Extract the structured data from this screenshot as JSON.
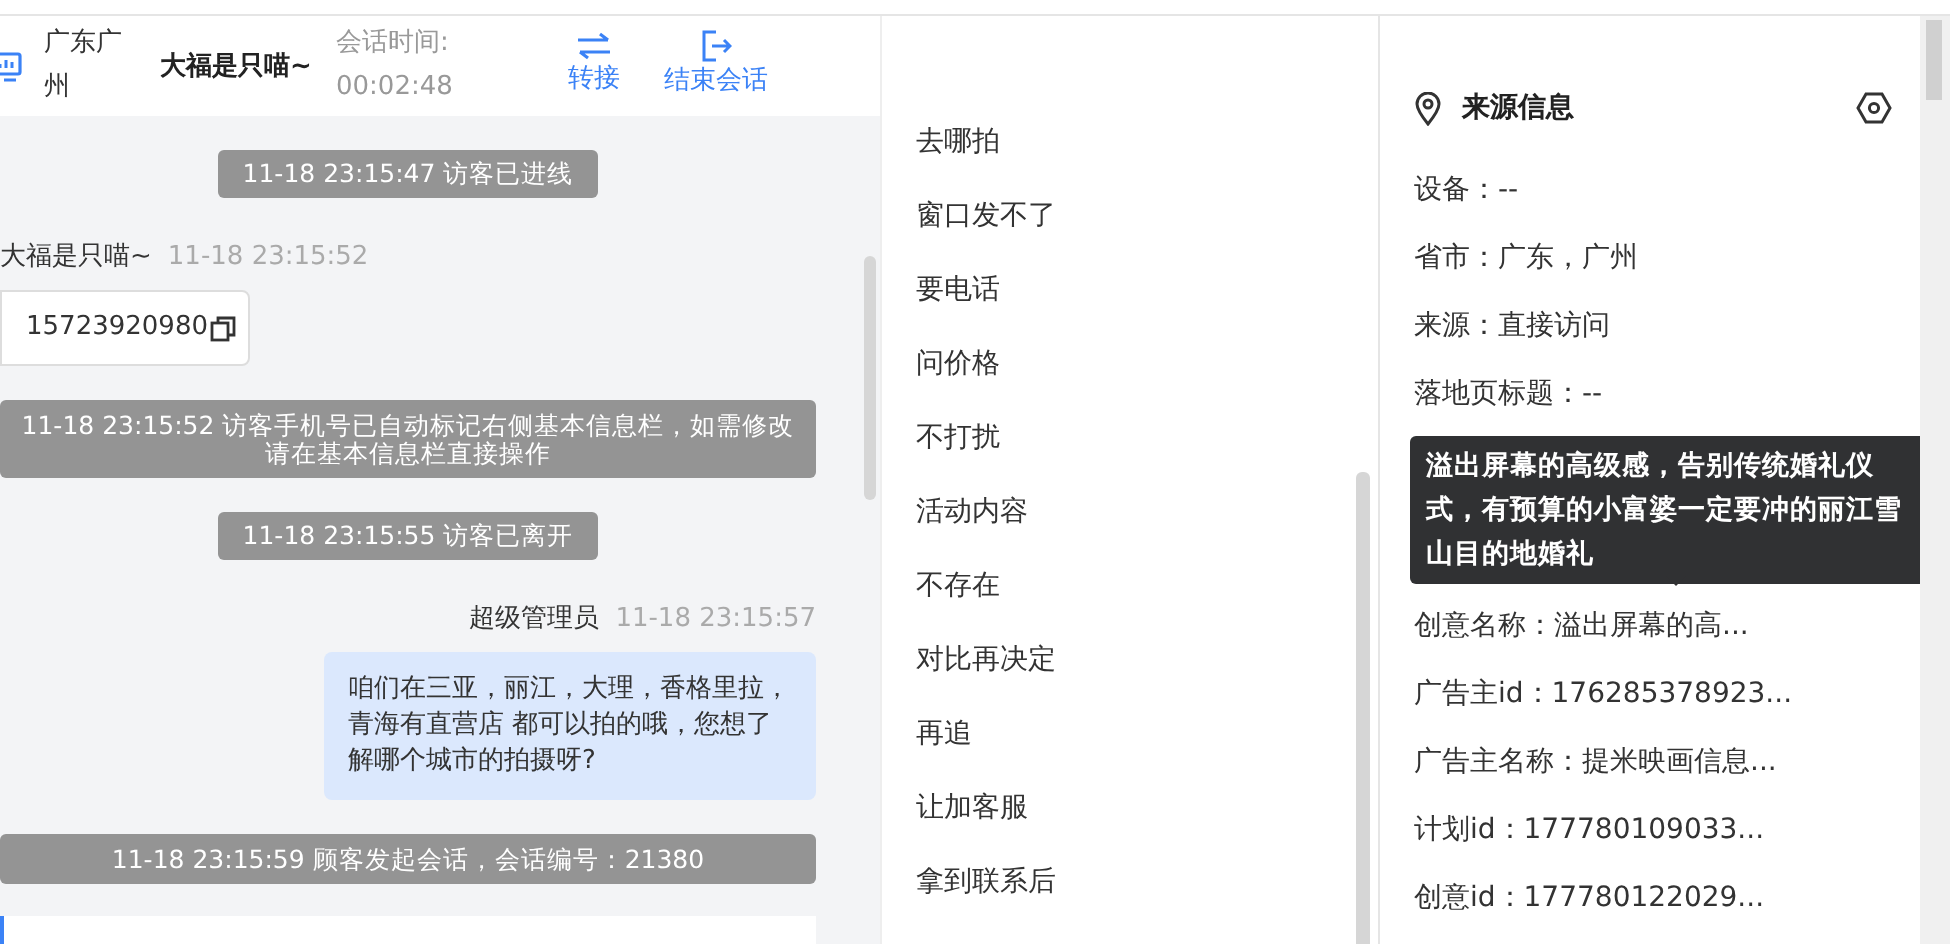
{
  "header": {
    "location": "广东广州",
    "visitor_name": "大福是只喵~",
    "duration_label": "会话时间:",
    "duration": "00:02:48",
    "actions": [
      {
        "kind": "transfer",
        "label": "转接"
      },
      {
        "kind": "end",
        "label": "结束会话"
      }
    ]
  },
  "messages": [
    {
      "kind": "system",
      "text": "11-18 23:15:47 访客已进线"
    },
    {
      "kind": "visitor",
      "sender": "大福是只喵~",
      "time": "11-18 23:15:52",
      "text": "15723920980"
    },
    {
      "kind": "system",
      "text": "11-18 23:15:52 访客手机号已自动标记右侧基本信息栏，如需修改请在基本信息栏直接操作"
    },
    {
      "kind": "system",
      "text": "11-18 23:15:55 访客已离开"
    },
    {
      "kind": "agent",
      "sender": "超级管理员",
      "time": "11-18 23:15:57",
      "text": "咱们在三亚，丽江，大理，香格里拉，青海有直营店 都可以拍的哦，您想了解哪个城市的拍摄呀?"
    },
    {
      "kind": "system",
      "text": "11-18 23:15:59 顾客发起会话，会话编号：21380"
    }
  ],
  "quick_replies": [
    "去哪拍",
    "窗口发不了",
    "要电话",
    "问价格",
    "不打扰",
    "活动内容",
    "不存在",
    "对比再决定",
    "再追",
    "让加客服",
    "拿到联系后"
  ],
  "source_info": {
    "title": "来源信息",
    "fields": [
      {
        "text": "设备：--"
      },
      {
        "text": "省市：广东，广州"
      },
      {
        "text": "来源：直接访问"
      },
      {
        "text": "落地页标题：--"
      },
      {
        "text": "创意名称：溢出屏幕的高...",
        "tooltip": "溢出屏幕的高级感，告别传统婚礼仪式，有预算的小富婆一定要冲的丽江雪山目的地婚礼"
      },
      {
        "text": "广告主id：176285378923..."
      },
      {
        "text": "广告主名称：提米映画信息..."
      },
      {
        "text": "计划id：177780109033..."
      },
      {
        "text": "创意id：177780122029..."
      }
    ]
  }
}
